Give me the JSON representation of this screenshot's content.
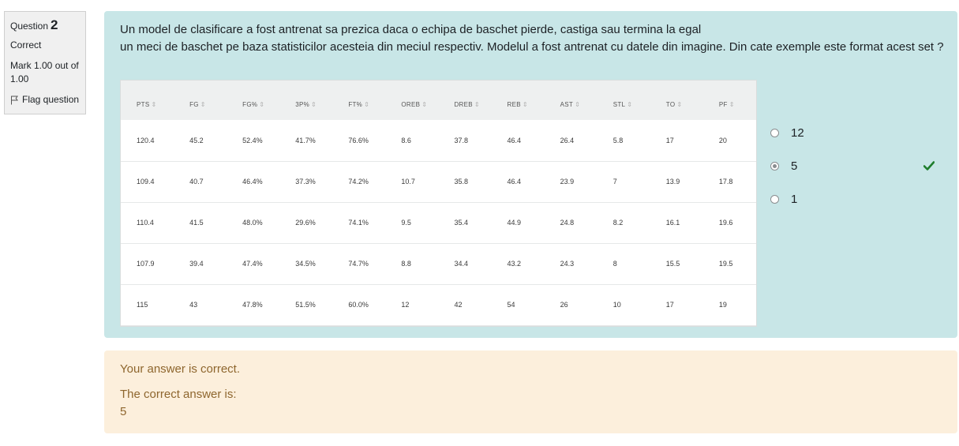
{
  "info": {
    "question_label": "Question",
    "question_number": "2",
    "state": "Correct",
    "grade": "Mark 1.00 out of 1.00",
    "flag_label": "Flag question",
    "icons": {
      "flag": "flag-icon"
    }
  },
  "question": {
    "text_line1": "Un model de clasificare a fost antrenat sa prezica daca o echipa de baschet pierde, castiga sau termina la egal",
    "text_line2": "un meci de baschet pe baza statisticilor acesteia din meciul respectiv. Modelul a fost antrenat cu datele din imagine. Din cate exemple este format acest set ?"
  },
  "stats_table": {
    "columns": [
      "PTS",
      "FG",
      "FG%",
      "3P%",
      "FT%",
      "OREB",
      "DREB",
      "REB",
      "AST",
      "STL",
      "TO",
      "PF"
    ],
    "sort_glyph": "⇕",
    "rows": [
      [
        "120.4",
        "45.2",
        "52.4%",
        "41.7%",
        "76.6%",
        "8.6",
        "37.8",
        "46.4",
        "26.4",
        "5.8",
        "17",
        "20"
      ],
      [
        "109.4",
        "40.7",
        "46.4%",
        "37.3%",
        "74.2%",
        "10.7",
        "35.8",
        "46.4",
        "23.9",
        "7",
        "13.9",
        "17.8"
      ],
      [
        "110.4",
        "41.5",
        "48.0%",
        "29.6%",
        "74.1%",
        "9.5",
        "35.4",
        "44.9",
        "24.8",
        "8.2",
        "16.1",
        "19.6"
      ],
      [
        "107.9",
        "39.4",
        "47.4%",
        "34.5%",
        "74.7%",
        "8.8",
        "34.4",
        "43.2",
        "24.3",
        "8",
        "15.5",
        "19.5"
      ],
      [
        "115",
        "43",
        "47.8%",
        "51.5%",
        "60.0%",
        "12",
        "42",
        "54",
        "26",
        "10",
        "17",
        "19"
      ]
    ]
  },
  "answers": {
    "options": [
      {
        "label": "12",
        "checked": false
      },
      {
        "label": "5",
        "checked": true,
        "correct": true
      },
      {
        "label": "1",
        "checked": false
      }
    ],
    "icons": {
      "correct": "check-icon"
    }
  },
  "feedback": {
    "specific": "Your answer is correct.",
    "right_answer_label": "The correct answer is:",
    "right_answer_value": "5"
  },
  "colors": {
    "formulation_bg": "#c8e6e7",
    "info_bg": "#f0f0f0",
    "outcome_bg": "#fcefdc",
    "outcome_text": "#8e662e",
    "correct_tick": "#1f7e2d"
  }
}
